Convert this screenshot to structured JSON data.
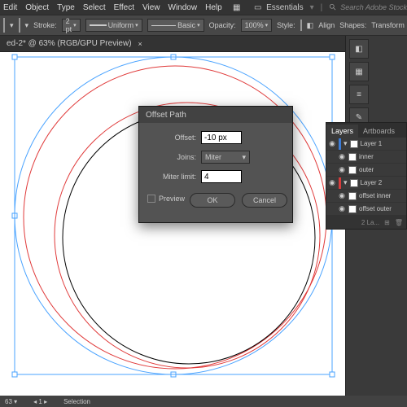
{
  "menu": {
    "items": [
      "Edit",
      "Object",
      "Type",
      "Select",
      "Effect",
      "View",
      "Window",
      "Help"
    ]
  },
  "topbar2": {
    "workspace": "Essentials",
    "search_placeholder": "Search Adobe Stock"
  },
  "ctrl": {
    "stroke_label": "Stroke:",
    "stroke_val": "2 pt",
    "brush": "Uniform",
    "profile": "Basic",
    "opacity_label": "Opacity:",
    "opacity_val": "100%",
    "style_label": "Style:",
    "align": "Align",
    "shapes": "Shapes:",
    "transform": "Transform"
  },
  "doc": {
    "tab": "ed-2* @ 63% (RGB/GPU Preview)"
  },
  "dialog": {
    "title": "Offset Path",
    "offset_label": "Offset:",
    "offset_val": "-10 px",
    "joins_label": "Joins:",
    "joins_val": "Miter",
    "miter_label": "Miter limit:",
    "miter_val": "4",
    "preview": "Preview",
    "ok": "OK",
    "cancel": "Cancel"
  },
  "layers": {
    "tab_layers": "Layers",
    "tab_artboards": "Artboards",
    "l1": "Layer 1",
    "l1a": "inner",
    "l1b": "outer",
    "l2": "Layer 2",
    "l2a": "offset inner",
    "l2b": "offset outer",
    "footer": "2 La..."
  },
  "status": {
    "zoom": "63",
    "tool": "Selection"
  }
}
